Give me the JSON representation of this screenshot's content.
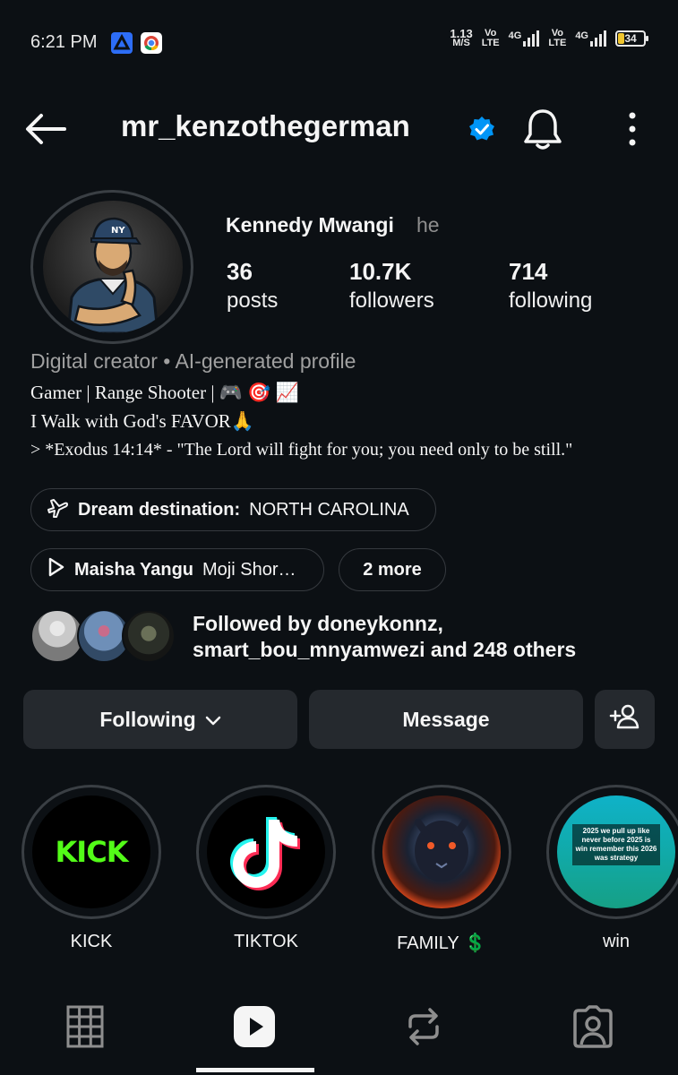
{
  "status_bar": {
    "time": "6:21 PM",
    "speed_value": "1.13",
    "speed_unit": "M/S",
    "sim1_top": "Vo",
    "sim1_bottom": "LTE",
    "net1": "4G",
    "sim2_top": "Vo",
    "sim2_bottom": "LTE",
    "net2": "4G",
    "battery": "34",
    "icons": [
      "drive-icon",
      "chrome-icon"
    ]
  },
  "header": {
    "username": "mr_kenzothegerman",
    "icons": [
      "back-arrow-icon",
      "verified-badge-icon",
      "bell-icon",
      "more-vertical-icon"
    ]
  },
  "profile": {
    "display_name": "Kennedy Mwangi",
    "pronoun": "he",
    "stats": [
      {
        "value": "36",
        "label": "posts"
      },
      {
        "value": "10.7K",
        "label": "followers"
      },
      {
        "value": "714",
        "label": "following"
      }
    ],
    "category": "Digital creator • AI-generated profile",
    "bio_lines": [
      "Gamer | Range Shooter |  🎮 🎯 📈",
      "I Walk with God's FAVOR🙏",
      "> *Exodus 14:14* - \"The Lord will fight for you; you need only to be still.\""
    ]
  },
  "pills": {
    "destination_label": "Dream destination:",
    "destination_value": "NORTH CAROLINA",
    "music_title": "Maisha Yangu",
    "music_artist": "Moji Shor…",
    "more": "2 more"
  },
  "followed_by": {
    "line1": "Followed by doneykonnz,",
    "line2": "smart_bou_mnyamwezi and 248 others"
  },
  "actions": {
    "following": "Following",
    "message": "Message"
  },
  "highlights": [
    {
      "label": "KICK",
      "logo_text": "KICK"
    },
    {
      "label": "TIKTOK"
    },
    {
      "label": "FAMILY 💲"
    },
    {
      "label": "win",
      "cover_text": "2025 we pull up like never before 2025 is win remember this 2026 was strategy"
    }
  ],
  "colors": {
    "background": "#0c1014",
    "button": "#25292e",
    "verified": "#0095f6",
    "kick_green": "#53fc18",
    "secondary_text": "#a0a0a0"
  },
  "bottom_nav": [
    "grid-icon",
    "reels-icon",
    "reposts-icon",
    "tagged-icon"
  ]
}
